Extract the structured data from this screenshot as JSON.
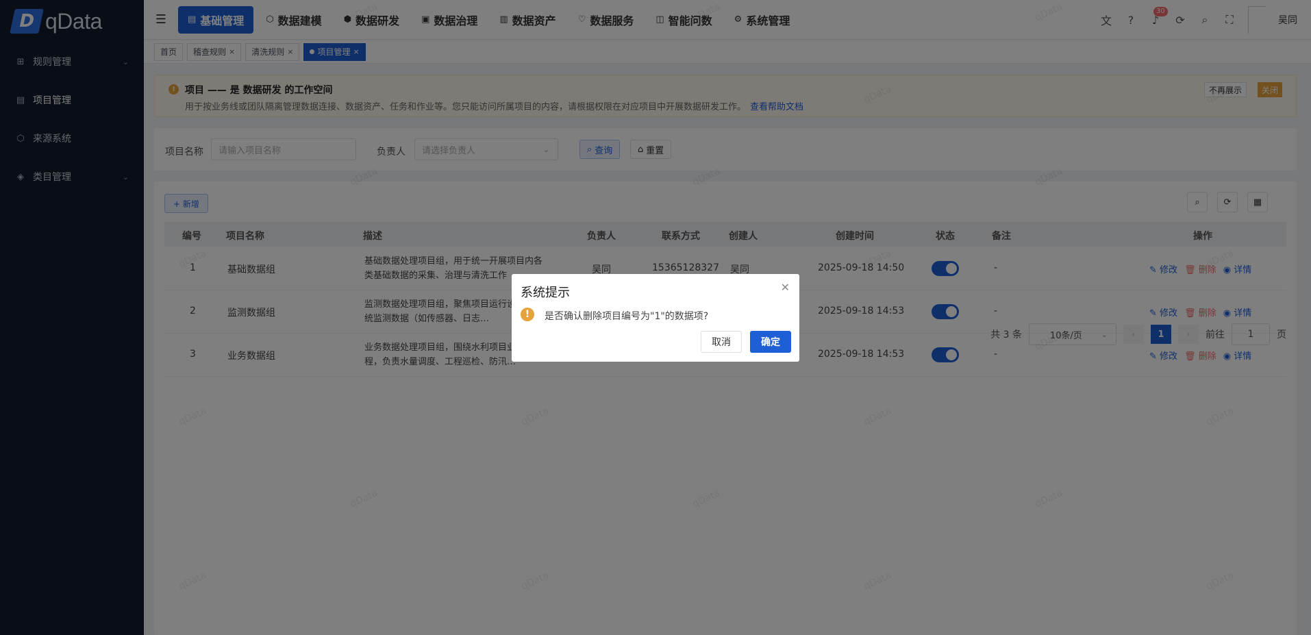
{
  "app": {
    "logo_text": "qData"
  },
  "sidebar": {
    "items": [
      {
        "label": "规则管理",
        "icon": "grid-icon",
        "expandable": true
      },
      {
        "label": "项目管理",
        "icon": "document-icon",
        "expandable": false
      },
      {
        "label": "来源系统",
        "icon": "cube-icon",
        "expandable": false
      },
      {
        "label": "类目管理",
        "icon": "layers-icon",
        "expandable": true
      }
    ]
  },
  "topnav": {
    "items": [
      "基础管理",
      "数据建模",
      "数据研发",
      "数据治理",
      "数据资产",
      "数据服务",
      "智能问数",
      "系统管理"
    ],
    "notification_count": "30",
    "user_name": "吴同"
  },
  "tags": [
    {
      "label": "首页",
      "closable": false
    },
    {
      "label": "稽查规则",
      "closable": true
    },
    {
      "label": "清洗规则",
      "closable": true
    },
    {
      "label": "项目管理",
      "closable": true
    }
  ],
  "notice": {
    "title": "项目 —— 是 数据研发 的工作空间",
    "desc": "用于按业务线或团队隔离管理数据连接、数据资产、任务和作业等。您只能访问所属项目的内容，请根据权限在对应项目中开展数据研发工作。",
    "link": "查看帮助文档",
    "no_more": "不再展示",
    "close": "关闭"
  },
  "search": {
    "name_label": "项目名称",
    "name_placeholder": "请输入项目名称",
    "owner_label": "负责人",
    "owner_placeholder": "请选择负责人",
    "query": "查询",
    "reset": "重置"
  },
  "table": {
    "add_label": "+ 新增",
    "headers": [
      "编号",
      "项目名称",
      "描述",
      "负责人",
      "联系方式",
      "创建人",
      "创建时间",
      "状态",
      "备注",
      "操作"
    ],
    "rows": [
      {
        "id": "1",
        "name": "基础数据组",
        "desc": "基础数据处理项目组，用于统一开展项目内各类基础数据的采集、治理与清洗工作",
        "owner": "吴同",
        "phone": "15365128327",
        "creator": "吴同",
        "created": "2025-09-18 14:50",
        "status": true,
        "remark": "-"
      },
      {
        "id": "2",
        "name": "监测数据组",
        "desc": "监测数据处理项目组，聚焦项目运行设备与系统监测数据（如传感器、日志…",
        "owner": "",
        "phone": "",
        "creator": "",
        "created": "2025-09-18 14:53",
        "status": true,
        "remark": "-"
      },
      {
        "id": "3",
        "name": "业务数据组",
        "desc": "业务数据处理项目组，围绕水利项目业务流程，负责水量调度、工程巡检、防汛…",
        "owner": "",
        "phone": "",
        "creator": "",
        "created": "2025-09-18 14:53",
        "status": true,
        "remark": "-"
      }
    ],
    "actions": {
      "edit": "修改",
      "delete": "删除",
      "detail": "详情"
    }
  },
  "pagination": {
    "total": "共 3 条",
    "page_size": "10条/页",
    "current": "1",
    "goto_label": "前往",
    "goto_value": "1",
    "page_suffix": "页"
  },
  "watermark": "qData",
  "dialog": {
    "title": "系统提示",
    "message": "是否确认删除项目编号为\"1\"的数据项?",
    "cancel": "取消",
    "confirm": "确定"
  },
  "colors": {
    "primary": "#1f5fd6",
    "sidebar_bg": "#131a2b",
    "warning": "#e6a23c",
    "danger": "#f56c6c"
  }
}
